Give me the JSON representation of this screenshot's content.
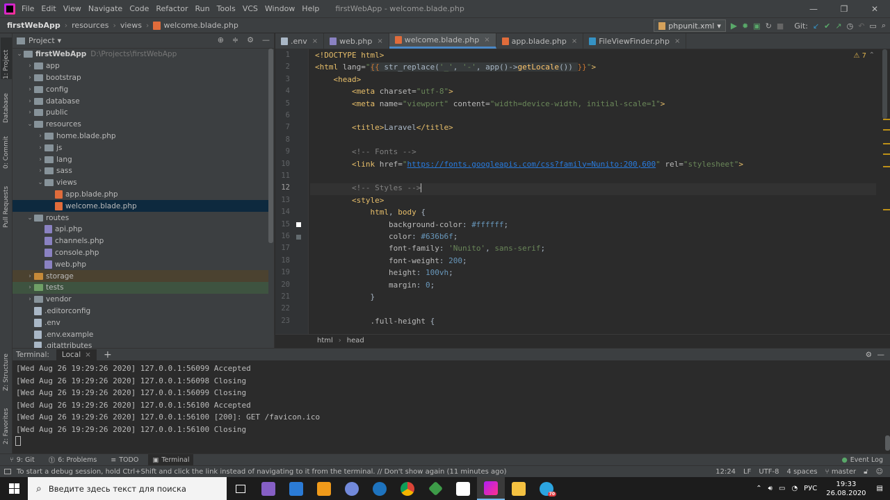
{
  "app": {
    "menu": [
      "File",
      "Edit",
      "View",
      "Navigate",
      "Code",
      "Refactor",
      "Run",
      "Tools",
      "VCS",
      "Window",
      "Help"
    ],
    "window_title": "firstWebApp - welcome.blade.php"
  },
  "navbar": {
    "breadcrumb": [
      "firstWebApp",
      "resources",
      "views",
      "welcome.blade.php"
    ],
    "run_config": "phpunit.xml",
    "git_label": "Git:"
  },
  "project_panel": {
    "title": "Project",
    "root": {
      "name": "firstWebApp",
      "path": "D:\\Projects\\firstWebApp"
    },
    "items": [
      {
        "label": "app",
        "depth": 1,
        "type": "folder",
        "arrow": "›"
      },
      {
        "label": "bootstrap",
        "depth": 1,
        "type": "folder",
        "arrow": "›"
      },
      {
        "label": "config",
        "depth": 1,
        "type": "folder",
        "arrow": "›"
      },
      {
        "label": "database",
        "depth": 1,
        "type": "folder",
        "arrow": "›"
      },
      {
        "label": "public",
        "depth": 1,
        "type": "folder",
        "arrow": "›"
      },
      {
        "label": "resources",
        "depth": 1,
        "type": "folder",
        "arrow": "⌄"
      },
      {
        "label": "home.blade.php",
        "depth": 2,
        "type": "folder",
        "arrow": "›"
      },
      {
        "label": "js",
        "depth": 2,
        "type": "folder",
        "arrow": "›"
      },
      {
        "label": "lang",
        "depth": 2,
        "type": "folder",
        "arrow": "›"
      },
      {
        "label": "sass",
        "depth": 2,
        "type": "folder",
        "arrow": "›"
      },
      {
        "label": "views",
        "depth": 2,
        "type": "folder",
        "arrow": "⌄"
      },
      {
        "label": "app.blade.php",
        "depth": 3,
        "type": "blade",
        "arrow": ""
      },
      {
        "label": "welcome.blade.php",
        "depth": 3,
        "type": "blade",
        "arrow": "",
        "selected": true
      },
      {
        "label": "routes",
        "depth": 1,
        "type": "folder",
        "arrow": "⌄"
      },
      {
        "label": "api.php",
        "depth": 2,
        "type": "php",
        "arrow": ""
      },
      {
        "label": "channels.php",
        "depth": 2,
        "type": "php",
        "arrow": ""
      },
      {
        "label": "console.php",
        "depth": 2,
        "type": "php",
        "arrow": ""
      },
      {
        "label": "web.php",
        "depth": 2,
        "type": "php",
        "arrow": ""
      },
      {
        "label": "storage",
        "depth": 1,
        "type": "folder-orange",
        "arrow": "›",
        "highlight": "storage"
      },
      {
        "label": "tests",
        "depth": 1,
        "type": "folder-green",
        "arrow": "›",
        "highlight": "tests"
      },
      {
        "label": "vendor",
        "depth": 1,
        "type": "folder",
        "arrow": "›"
      },
      {
        "label": ".editorconfig",
        "depth": 1,
        "type": "cfg",
        "arrow": ""
      },
      {
        "label": ".env",
        "depth": 1,
        "type": "cfg",
        "arrow": ""
      },
      {
        "label": ".env.example",
        "depth": 1,
        "type": "cfg",
        "arrow": ""
      },
      {
        "label": ".gitattributes",
        "depth": 1,
        "type": "cfg",
        "arrow": ""
      }
    ]
  },
  "left_strip": [
    "1: Project",
    "Database",
    "0: Commit",
    "Pull Requests"
  ],
  "left_strip_bottom": [
    "Z: Structure",
    "2: Favorites"
  ],
  "tabs": [
    {
      "label": ".env",
      "active": false
    },
    {
      "label": "web.php",
      "active": false
    },
    {
      "label": "welcome.blade.php",
      "active": true
    },
    {
      "label": "app.blade.php",
      "active": false
    },
    {
      "label": "FileViewFinder.php",
      "active": false
    }
  ],
  "editor": {
    "warnings": "7",
    "line_numbers": [
      "1",
      "2",
      "3",
      "4",
      "5",
      "6",
      "7",
      "8",
      "9",
      "10",
      "11",
      "12",
      "13",
      "14",
      "15",
      "16",
      "17",
      "18",
      "19",
      "20",
      "21",
      "22",
      "23"
    ],
    "current_line": 12,
    "breadcrumb": [
      "html",
      "head"
    ]
  },
  "terminal": {
    "label": "Terminal:",
    "tab": "Local",
    "lines": [
      "[Wed Aug 26 19:29:26 2020] 127.0.0.1:56099 Accepted",
      "[Wed Aug 26 19:29:26 2020] 127.0.0.1:56098 Closing",
      "[Wed Aug 26 19:29:26 2020] 127.0.0.1:56099 Closing",
      "[Wed Aug 26 19:29:26 2020] 127.0.0.1:56100 Accepted",
      "[Wed Aug 26 19:29:26 2020] 127.0.0.1:56100 [200]: GET /favicon.ico",
      "[Wed Aug 26 19:29:26 2020] 127.0.0.1:56100 Closing"
    ]
  },
  "tool_windows": [
    {
      "label": "9: Git",
      "active": false
    },
    {
      "label": "6: Problems",
      "active": false
    },
    {
      "label": "TODO",
      "active": false
    },
    {
      "label": "Terminal",
      "active": true
    }
  ],
  "event_log": "Event Log",
  "status": {
    "message": "To start a debug session, hold Ctrl+Shift and click the link instead of navigating to it from the terminal. // Don't show again (11 minutes ago)",
    "position": "12:24",
    "line_sep": "LF",
    "encoding": "UTF-8",
    "indent": "4 spaces",
    "branch": "master"
  },
  "taskbar": {
    "search_placeholder": "Введите здесь текст для поиска",
    "lang": "РУС",
    "time": "19:33",
    "date": "26.08.2020",
    "telegram_badge": "70"
  }
}
